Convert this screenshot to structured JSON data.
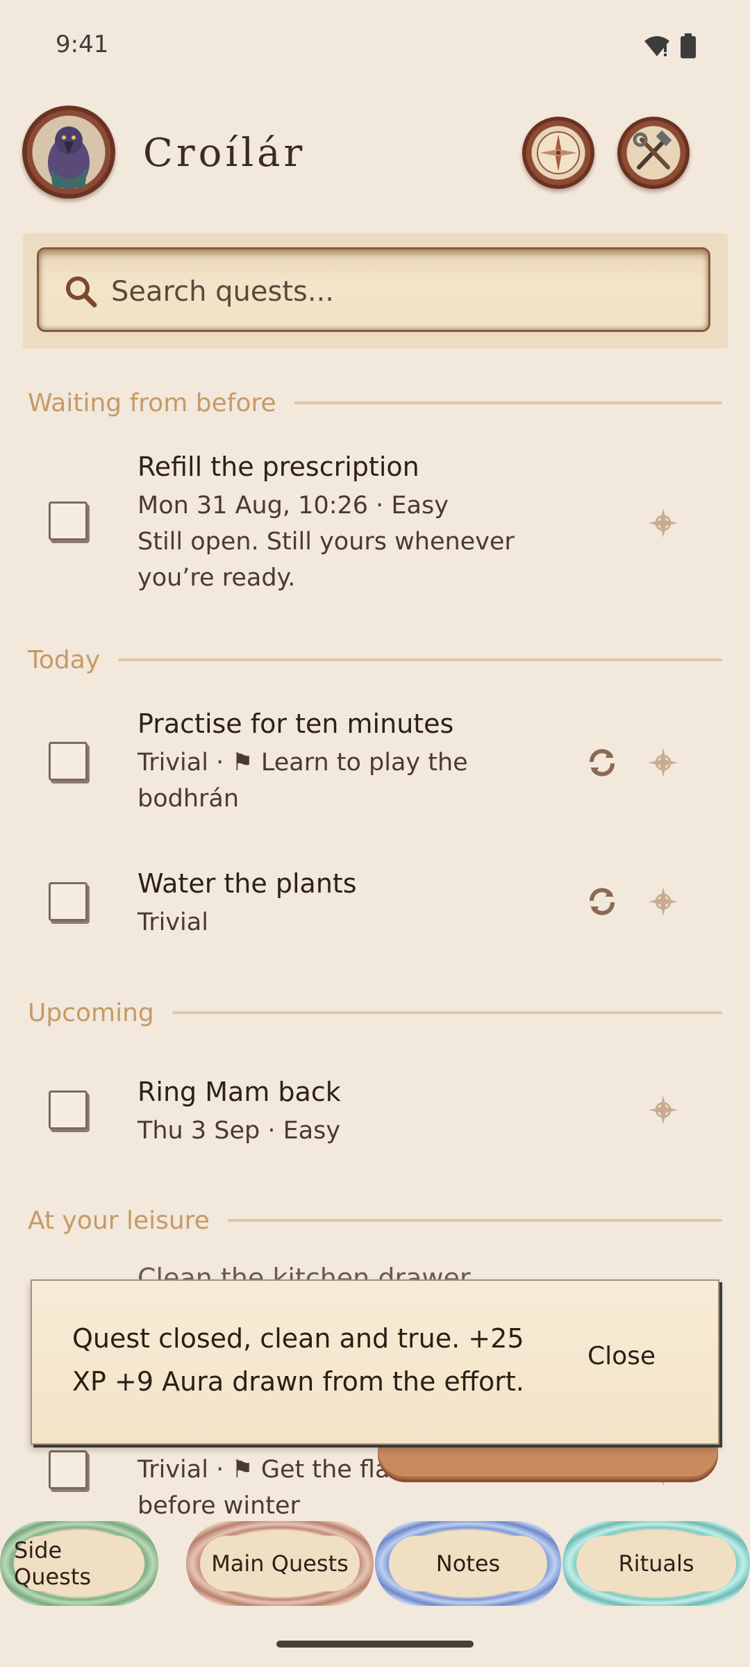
{
  "status": {
    "time": "9:41"
  },
  "header": {
    "title": "Croílár"
  },
  "search": {
    "placeholder": "Search quests..."
  },
  "sections": {
    "waiting": "Waiting from before",
    "today": "Today",
    "upcoming": "Upcoming",
    "leisure": "At your leisure"
  },
  "quests": [
    {
      "title": "Refill the prescription",
      "meta": "Mon 31 Aug, 10:26 · Easy",
      "desc": "Still open. Still yours whenever you’re ready."
    },
    {
      "title": "Practise for ten minutes",
      "meta": "Trivial · ⚑ Learn to play the bodhrán"
    },
    {
      "title": "Water the plants",
      "meta": "Trivial"
    },
    {
      "title": "Ring Mam back",
      "meta": "Thu 3 Sep · Easy"
    },
    {
      "title": "Clean the kitchen drawer",
      "meta": "Trivial · ⚑ Get the flat sorted before winter"
    }
  ],
  "snackbar": {
    "message": "Quest closed, clean and true. +25 XP +9 Aura drawn from the effort.",
    "close_label": "Close"
  },
  "nav": {
    "side": "Side Quests",
    "main": "Main Quests",
    "notes": "Notes",
    "rituals": "Rituals"
  },
  "colors": {
    "background": "#f2e8dc",
    "accent": "#c59a66",
    "nav_side": "#8fbf94",
    "nav_main": "#c89a86",
    "nav_notes": "#8fa6dc",
    "nav_rituals": "#8fd3cd"
  },
  "icons": [
    "wifi-icon",
    "battery-icon",
    "raven-avatar-icon",
    "compass-icon",
    "tools-icon",
    "search-icon",
    "compass-rose-icon",
    "repeat-icon"
  ]
}
